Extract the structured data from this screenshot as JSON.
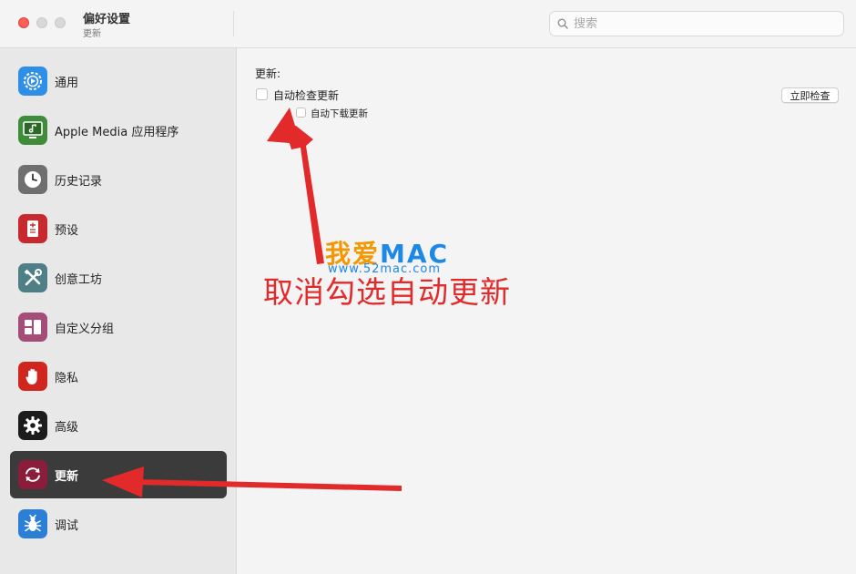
{
  "window": {
    "title": "偏好设置",
    "subtitle": "更新"
  },
  "search": {
    "placeholder": "搜索"
  },
  "sidebar": {
    "items": [
      {
        "label": "通用",
        "icon": "gear-dial-icon",
        "color": "#2f8fe8"
      },
      {
        "label": "Apple Media 应用程序",
        "icon": "music-display-icon",
        "color": "#3f8d3a"
      },
      {
        "label": "历史记录",
        "icon": "clock-icon",
        "color": "#6f6f6f"
      },
      {
        "label": "预设",
        "icon": "preset-document-icon",
        "color": "#c8292f"
      },
      {
        "label": "创意工坊",
        "icon": "tools-icon",
        "color": "#4f7f86"
      },
      {
        "label": "自定义分组",
        "icon": "grid-group-icon",
        "color": "#a54c78"
      },
      {
        "label": "隐私",
        "icon": "hand-icon",
        "color": "#d0261f"
      },
      {
        "label": "高级",
        "icon": "gear-icon",
        "color": "#1c1c1c"
      },
      {
        "label": "更新",
        "icon": "refresh-icon",
        "color": "#8a1e3a",
        "active": true
      },
      {
        "label": "调试",
        "icon": "bug-icon",
        "color": "#2b7fd6"
      }
    ]
  },
  "main": {
    "section_title": "更新:",
    "auto_check_label": "自动检查更新",
    "auto_check_checked": false,
    "auto_download_label": "自动下载更新",
    "auto_download_checked": false,
    "check_now_label": "立即检查"
  },
  "annotation": {
    "watermark_wo": "我爱",
    "watermark_mac": "MAC",
    "watermark_url": "www.52mac.com",
    "text": "取消勾选自动更新",
    "color": "#e32a2a"
  }
}
